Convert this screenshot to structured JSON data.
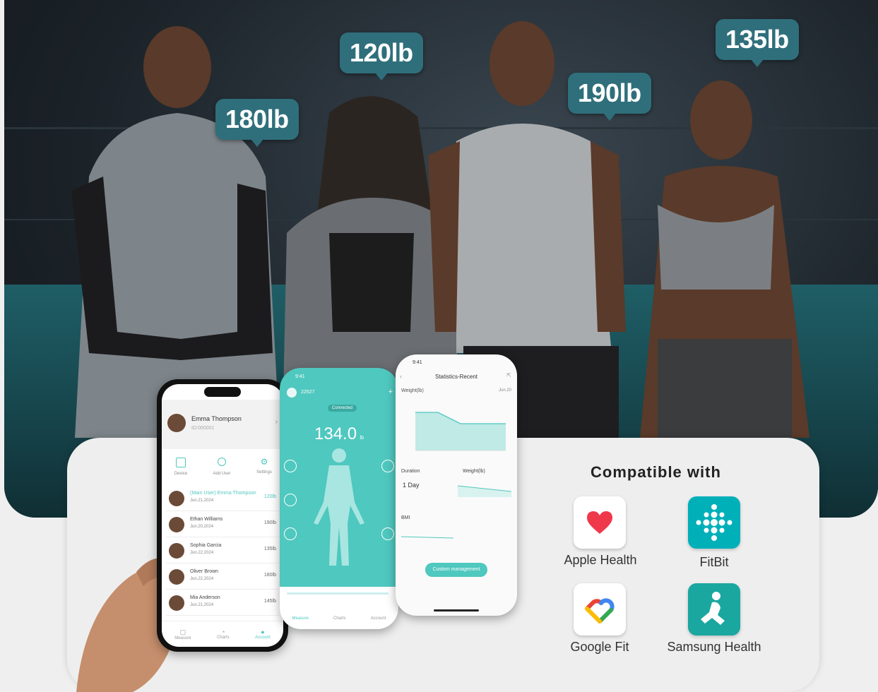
{
  "weights": [
    {
      "label": "180lb"
    },
    {
      "label": "120lb"
    },
    {
      "label": "190lb"
    },
    {
      "label": "135lb"
    }
  ],
  "phone1": {
    "user_name": "Emma Thompson",
    "user_id": "ID:000001",
    "actions": [
      "Device",
      "Add User",
      "Settings"
    ],
    "rows": [
      {
        "name": "(Main User) Emma Thompson",
        "date": "Jun.21,2024",
        "value": "120lb"
      },
      {
        "name": "Ethan Williams",
        "date": "Jun.20,2024",
        "value": "190lb"
      },
      {
        "name": "Sophia Garcia",
        "date": "Jun.22,2024",
        "value": "135lb"
      },
      {
        "name": "Oliver Brown",
        "date": "Jun.22,2024",
        "value": "180lb"
      },
      {
        "name": "Mia Anderson",
        "date": "Jun.21,2024",
        "value": "145lb"
      }
    ],
    "tabs": [
      "Measure",
      "Charts",
      "Account"
    ]
  },
  "phone2": {
    "time": "9:41",
    "user": "22527",
    "status": "Connected",
    "weight": "134.0",
    "unit": "lb",
    "tabs": [
      "Measure",
      "Charts",
      "Account"
    ]
  },
  "phone3": {
    "time": "9:41",
    "title": "Statistics-Recent",
    "weight_label": "Weight(lb)",
    "date": "Jun.20",
    "duration_label": "Duration",
    "duration_value": "1 Day",
    "weight_small": "Weight(lb)",
    "bmi_label": "BMI",
    "button": "Custom management"
  },
  "compat": {
    "title": "Compatible with",
    "apps": [
      {
        "name": "Apple Health",
        "icon": "heart-icon"
      },
      {
        "name": "FitBit",
        "icon": "fitbit-dots-icon"
      },
      {
        "name": "Google Fit",
        "icon": "google-fit-heart-icon"
      },
      {
        "name": "Samsung Health",
        "icon": "samsung-health-runner-icon"
      }
    ]
  },
  "colors": {
    "accent": "#4fc8bf",
    "bubble": "#2f6f7b",
    "fitbit": "#00b0b9",
    "samsung": "#1aa7a0"
  }
}
